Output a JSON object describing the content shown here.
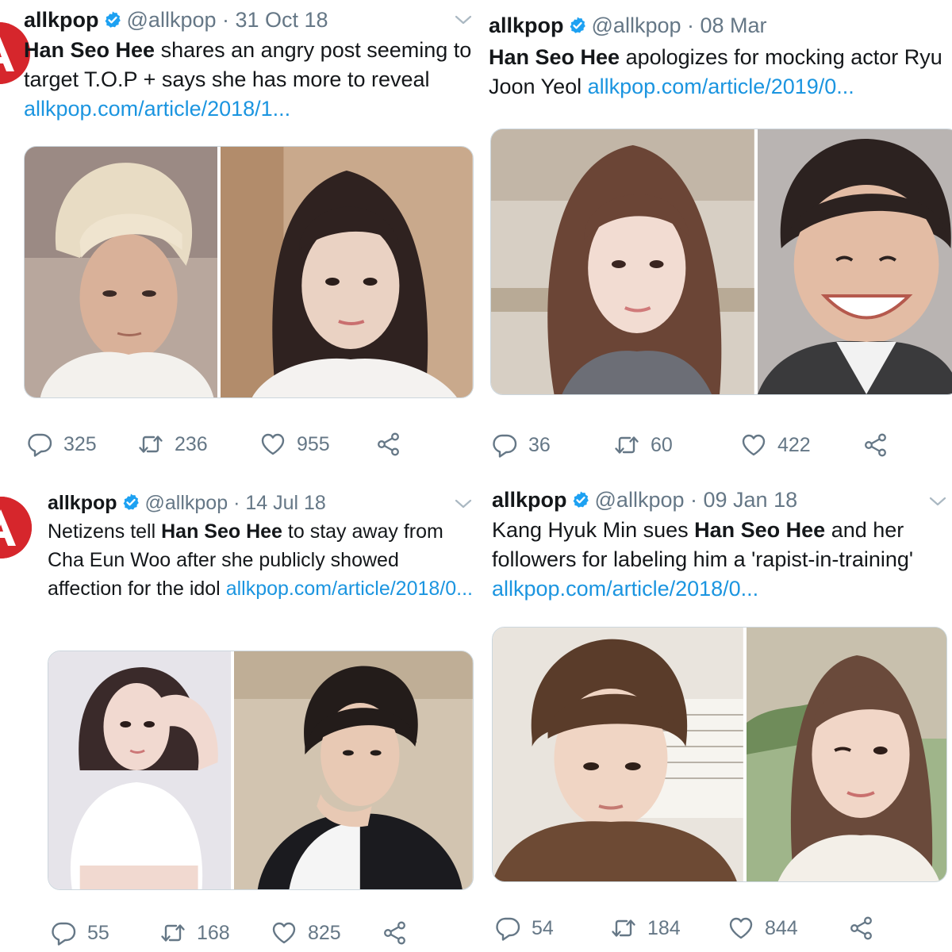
{
  "colors": {
    "accent": "#1b95e0",
    "muted": "#657786",
    "text": "#14171a",
    "brand": "#d6262c"
  },
  "tweets": [
    {
      "name": "allkpop",
      "handle": "@allkpop",
      "date": "31 Oct 18",
      "separator": " · ",
      "body": {
        "bold": "Han Seo Hee",
        "text": " shares an angry post seeming to target T.O.P + says she has more to reveal ",
        "link": "allkpop.com/article/2018/1..."
      },
      "media": [
        "photo-top-blond-man",
        "photo-han-seo-hee"
      ],
      "counts": {
        "replies": "325",
        "retweets": "236",
        "likes": "955"
      }
    },
    {
      "name": "allkpop",
      "handle": "@allkpop",
      "date": "08 Mar",
      "separator": " · ",
      "body": {
        "bold": "Han Seo Hee",
        "text": " apologizes for mocking actor Ryu Joon Yeol ",
        "link": "allkpop.com/article/2019/0..."
      },
      "media": [
        "photo-han-seo-hee",
        "photo-ryu-joon-yeol"
      ],
      "counts": {
        "replies": "36",
        "retweets": "60",
        "likes": "422"
      }
    },
    {
      "name": "allkpop",
      "handle": "@allkpop",
      "date": "14 Jul 18",
      "separator": " · ",
      "body": {
        "prefix": "Netizens tell ",
        "bold": "Han Seo Hee",
        "text": " to stay away from Cha Eun Woo after she publicly showed affection for the idol ",
        "link": "allkpop.com/article/2018/0..."
      },
      "media": [
        "photo-han-seo-hee",
        "photo-cha-eun-woo"
      ],
      "counts": {
        "replies": "55",
        "retweets": "168",
        "likes": "825"
      }
    },
    {
      "name": "allkpop",
      "handle": "@allkpop",
      "date": "09 Jan 18",
      "separator": " · ",
      "body": {
        "prefix": "Kang Hyuk Min sues ",
        "bold": "Han Seo Hee",
        "text": " and her followers for labeling him a 'rapist-in-training' ",
        "link": "allkpop.com/article/2018/0..."
      },
      "media": [
        "photo-kang-hyuk-min",
        "photo-han-seo-hee"
      ],
      "counts": {
        "replies": "54",
        "retweets": "184",
        "likes": "844"
      }
    }
  ]
}
